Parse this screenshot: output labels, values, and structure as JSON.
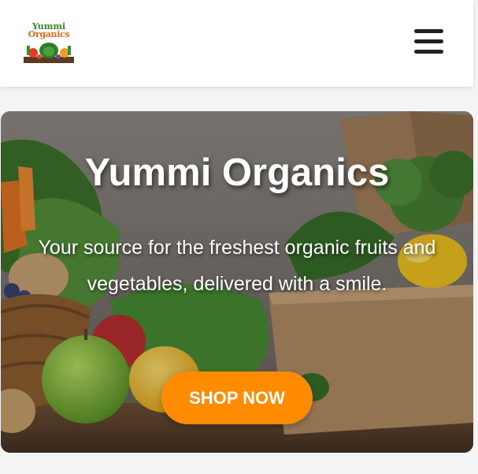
{
  "header": {
    "logo": {
      "line1": "Yummi",
      "line2": "Organics",
      "icon": "organic-farm-logo"
    },
    "menu_icon": "hamburger-menu-icon"
  },
  "hero": {
    "title": "Yummi Organics",
    "subtitle": "Your source for the freshest organic fruits and vegetables, delivered with a smile.",
    "cta_label": "SHOP NOW"
  },
  "colors": {
    "cta_background": "#ff8c00",
    "header_background": "#ffffff",
    "page_background": "#f4f4f4"
  }
}
